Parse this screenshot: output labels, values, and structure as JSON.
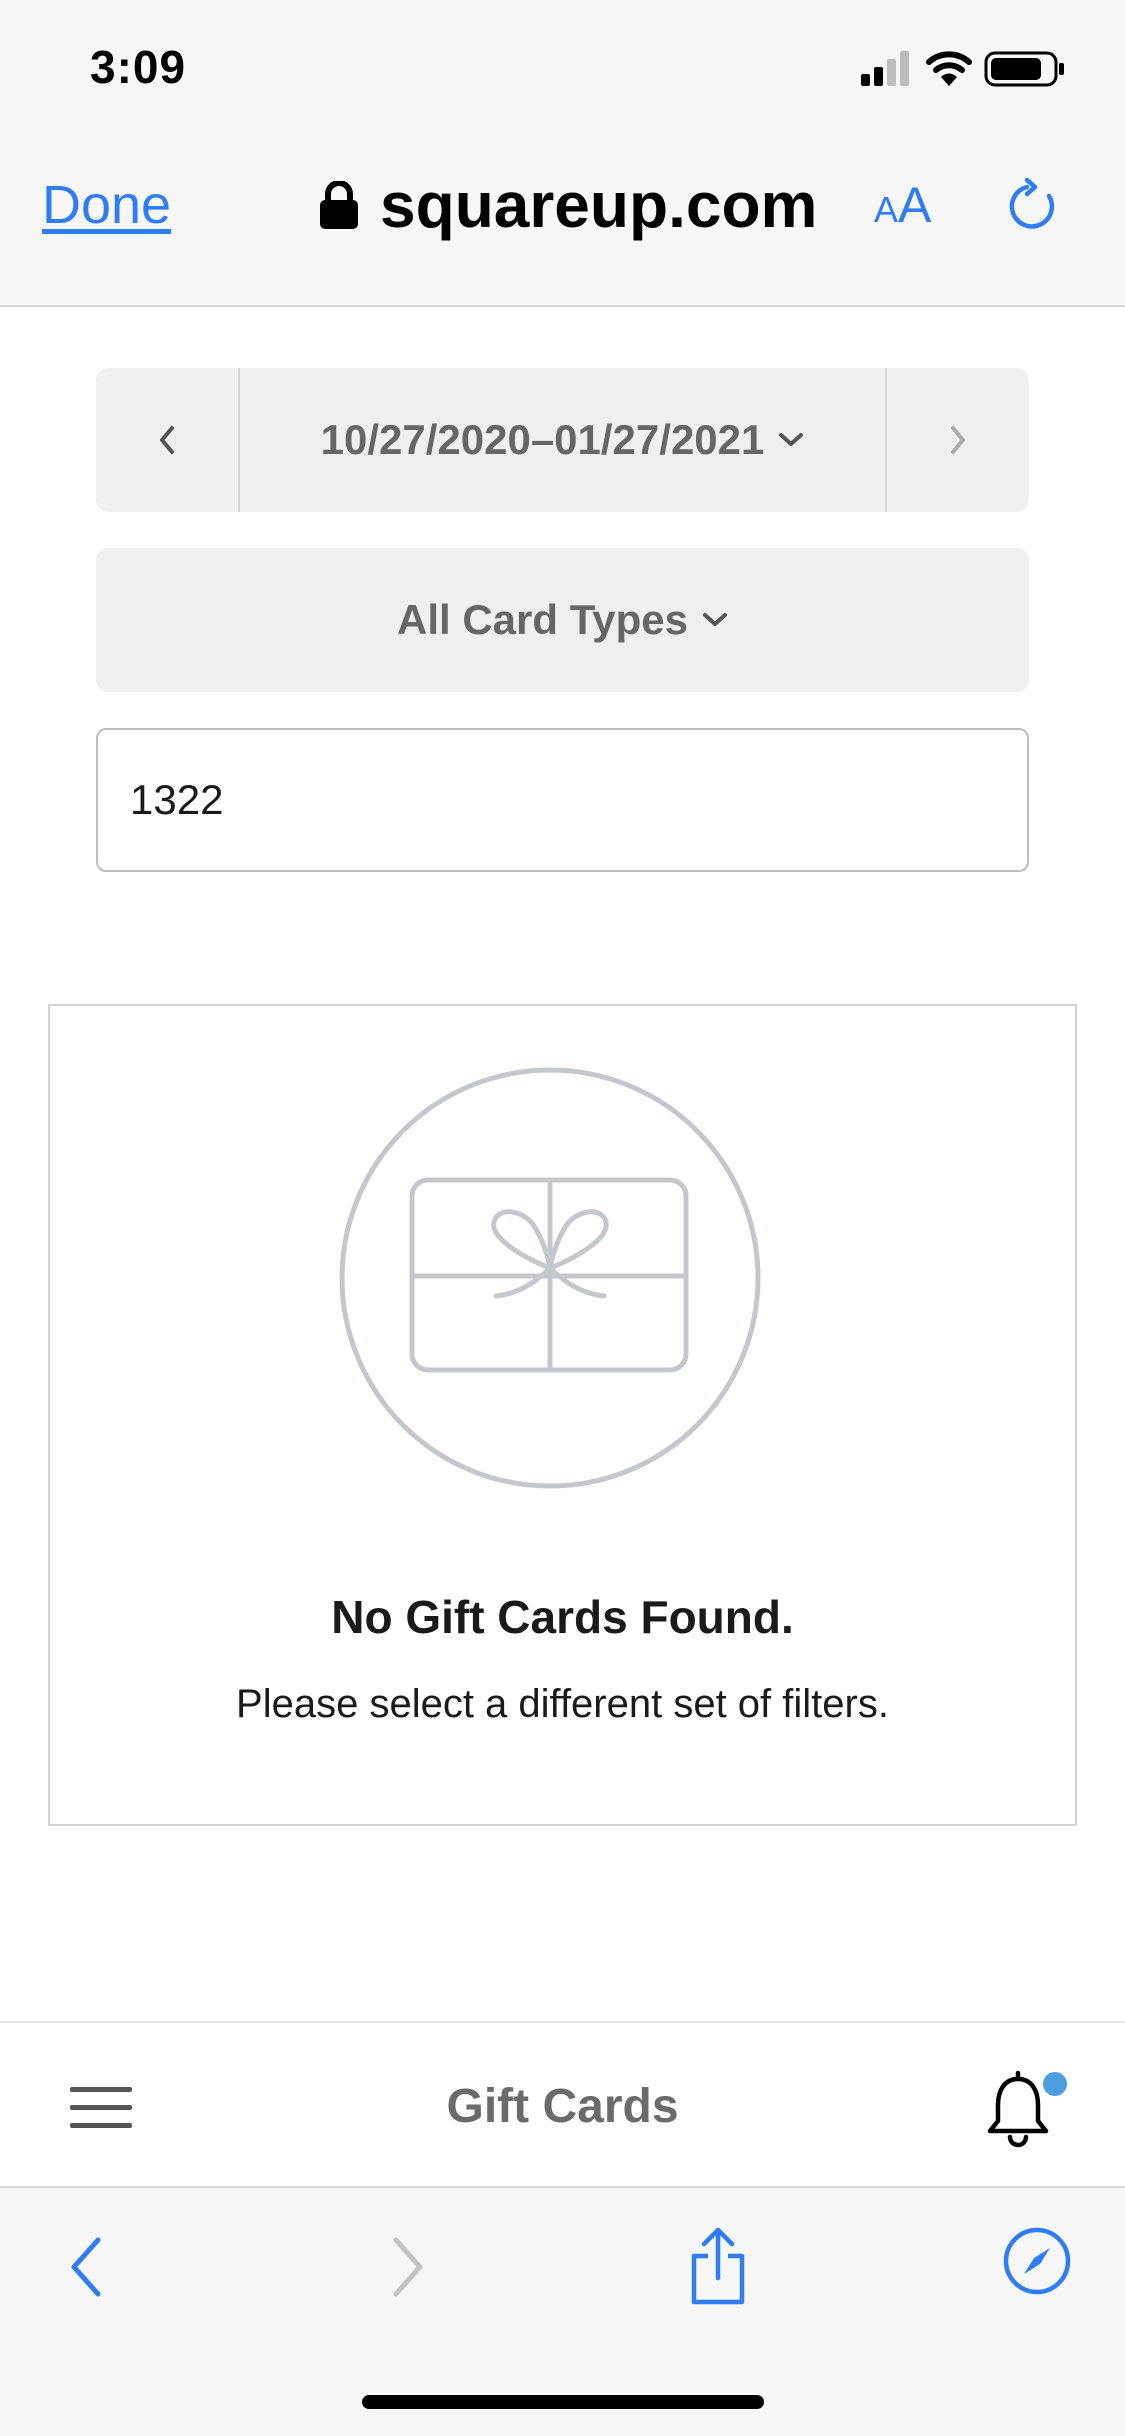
{
  "status_bar": {
    "time": "3:09",
    "icons": [
      "signal-icon",
      "wifi-icon",
      "battery-icon"
    ]
  },
  "browser": {
    "done_label": "Done",
    "url": "squareup.com",
    "text_size_label_small": "A",
    "text_size_label_big": "A",
    "icons": [
      "lock-icon",
      "reload-icon"
    ]
  },
  "filters": {
    "date_range": "10/27/2020–01/27/2021",
    "card_types": "All Card Types",
    "search_value": "1322"
  },
  "empty_state": {
    "title": "No Gift Cards Found.",
    "message": "Please select a different set of filters.",
    "icon": "gift-card-icon"
  },
  "app_bar": {
    "title": "Gift Cards",
    "notification_badge": true,
    "icons": [
      "hamburger-menu-icon",
      "bell-icon"
    ]
  },
  "toolbar": {
    "icons": [
      "back-arrow-icon",
      "forward-arrow-icon",
      "share-icon",
      "compass-icon"
    ]
  },
  "colors": {
    "accent_blue": "#2f7df6",
    "badge_blue": "#4a9ee0",
    "muted_gray": "#666666",
    "illustration_gray": "#c4c8cc"
  }
}
